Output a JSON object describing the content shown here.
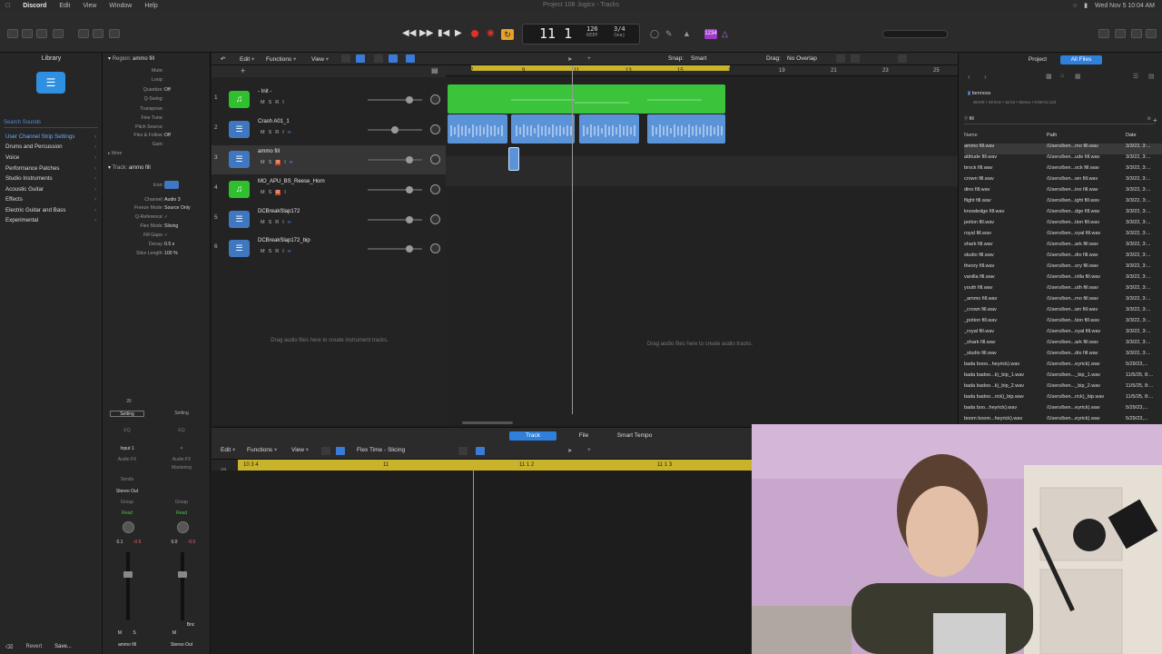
{
  "menubar": {
    "app": "Discord",
    "items": [
      "Edit",
      "View",
      "Window",
      "Help"
    ],
    "window_title": "Project 108 .logicx - Tracks",
    "clock": "Wed Nov 5  10:04 AM"
  },
  "controlbar": {
    "position": "11  1",
    "tempo": "126",
    "tempo_label": "KEEP",
    "signature": "3/4",
    "key": "Cmaj",
    "badge": "1234"
  },
  "library": {
    "title": "Library",
    "search_placeholder": "Search Sounds",
    "items": [
      "User Channel Strip Settings",
      "Drums and Percussion",
      "Voice",
      "Performance Patches",
      "Studio Instruments",
      "Acoustic Guitar",
      "Effects",
      "Electric Guitar and Bass",
      "Experimental"
    ],
    "revert": "Revert",
    "save": "Save..."
  },
  "inspector": {
    "region_label": "Region:",
    "region_name": "ammo fill",
    "rows": [
      {
        "k": "Mute:",
        "v": ""
      },
      {
        "k": "Loop:",
        "v": ""
      },
      {
        "k": "Quantize:",
        "v": "Off"
      },
      {
        "k": "Q-Swing:",
        "v": ""
      },
      {
        "k": "Transpose:",
        "v": ""
      },
      {
        "k": "Fine Tune:",
        "v": ""
      },
      {
        "k": "Pitch Source:",
        "v": ""
      },
      {
        "k": "Flex & Follow:",
        "v": "Off"
      },
      {
        "k": "Gain:",
        "v": ""
      }
    ],
    "more": "More",
    "track_label": "Track:",
    "track_name": "ammo fill",
    "track_rows": [
      {
        "k": "Icon:",
        "v": ""
      },
      {
        "k": "Channel:",
        "v": "Audio 3"
      },
      {
        "k": "Freeze Mode:",
        "v": "Source Only"
      },
      {
        "k": "Q-Reference:",
        "v": ""
      },
      {
        "k": "Flex Mode:",
        "v": "Slicing"
      },
      {
        "k": "Fill Gaps:",
        "v": ""
      },
      {
        "k": "Decay:",
        "v": "0.5 s"
      },
      {
        "k": "Slice Length:",
        "v": "100 %"
      }
    ],
    "strip_left": {
      "setting": "Setting",
      "eq": "EQ",
      "input": "Input 1",
      "fx": "Audio FX",
      "send": "Sends",
      "out": "Stereo Out",
      "group": "Group",
      "read": "Read",
      "val1": "0.1",
      "val2": "-0.9",
      "name": "ammo fill"
    },
    "strip_right": {
      "setting": "Setting",
      "eq": "EQ",
      "fx": "Audio FX",
      "fx2": "Mastering",
      "group": "Group",
      "read": "Read",
      "val1": "0.0",
      "val2": "-0.0",
      "bnc": "Bnc",
      "name": "Stereo Out"
    }
  },
  "tracks_header": {
    "edit": "Edit",
    "functions": "Functions",
    "view": "View",
    "snap_label": "Snap:",
    "snap_value": "Smart",
    "drag_label": "Drag:",
    "drag_value": "No Overlap"
  },
  "ruler": {
    "bars": [
      "7",
      "9",
      "11",
      "13",
      "15",
      "17",
      "19",
      "21",
      "23",
      "25"
    ]
  },
  "tracks": [
    {
      "num": "1",
      "name": "- Init -",
      "type": "midi"
    },
    {
      "num": "2",
      "name": "Crash A01_1",
      "type": "audio"
    },
    {
      "num": "3",
      "name": "ammo fill",
      "type": "audio"
    },
    {
      "num": "4",
      "name": "MO_APU_BS_Reese_Horn",
      "type": "midi"
    },
    {
      "num": "5",
      "name": "DCBreakSlap172",
      "type": "audio"
    },
    {
      "num": "6",
      "name": "DCBreakSlap172_bip",
      "type": "audio"
    }
  ],
  "track_buttons": {
    "m": "M",
    "s": "S",
    "r": "R",
    "i": "I"
  },
  "hints": {
    "instrument": "Drag audio files here to create instrument tracks.",
    "audio": "Drag audio files here to create audio tracks."
  },
  "browser": {
    "tab_project": "Project",
    "tab_all": "All Files",
    "folder": "bennoss",
    "info": "WAVE • 48 kHz • 16 bit • Stereo • 0:00:01:123",
    "search": "fill",
    "col_name": "Name",
    "col_path": "Path",
    "col_date": "Date",
    "files": [
      {
        "n": "ammo fill.wav",
        "p": "/Users/ben...mo fill.wav",
        "d": "3/3/22, 3:..."
      },
      {
        "n": "attitude fill.wav",
        "p": "/Users/ben...ude fill.wav",
        "d": "3/3/22, 3:..."
      },
      {
        "n": "brock fill.wav",
        "p": "/Users/ben...ock fill.wav",
        "d": "3/3/22, 3:..."
      },
      {
        "n": "crown fill.wav",
        "p": "/Users/ben...wn fill.wav",
        "d": "3/3/22, 3:..."
      },
      {
        "n": "dino fill.wav",
        "p": "/Users/ben...ino fill.wav",
        "d": "3/3/22, 3:..."
      },
      {
        "n": "flight fill.wav",
        "p": "/Users/ben...ight fill.wav",
        "d": "3/3/22, 3:..."
      },
      {
        "n": "knowledge fill.wav",
        "p": "/Users/ben...dge fill.wav",
        "d": "3/3/22, 3:..."
      },
      {
        "n": "potion fill.wav",
        "p": "/Users/ben...tion fill.wav",
        "d": "3/3/22, 3:..."
      },
      {
        "n": "royal fill.wav",
        "p": "/Users/ben...oyal fill.wav",
        "d": "3/3/22, 3:..."
      },
      {
        "n": "shark fill.wav",
        "p": "/Users/ben...ark fill.wav",
        "d": "3/3/22, 3:..."
      },
      {
        "n": "studio fill.wav",
        "p": "/Users/ben...dio fill.wav",
        "d": "3/3/22, 3:..."
      },
      {
        "n": "theory fill.wav",
        "p": "/Users/ben...ory fill.wav",
        "d": "3/3/22, 3:..."
      },
      {
        "n": "vanilla fill.wav",
        "p": "/Users/ben...nilla fill.wav",
        "d": "3/3/22, 3:..."
      },
      {
        "n": "youth fill.wav",
        "p": "/Users/ben...uth fill.wav",
        "d": "3/3/22, 3:..."
      },
      {
        "n": "_ammo fill.wav",
        "p": "/Users/ben...mo fill.wav",
        "d": "3/3/22, 3:..."
      },
      {
        "n": "_crown fill.wav",
        "p": "/Users/ben...wn fill.wav",
        "d": "3/3/22, 3:..."
      },
      {
        "n": "_potion fill.wav",
        "p": "/Users/ben...tion fill.wav",
        "d": "3/3/22, 3:..."
      },
      {
        "n": "_royal fill.wav",
        "p": "/Users/ben...oyal fill.wav",
        "d": "3/3/22, 3:..."
      },
      {
        "n": "_shark fill.wav",
        "p": "/Users/ben...ark fill.wav",
        "d": "3/3/22, 3:..."
      },
      {
        "n": "_studio fill.wav",
        "p": "/Users/ben...dio fill.wav",
        "d": "3/3/22, 3:..."
      },
      {
        "n": "bada booo...heyrick).wav",
        "p": "/Users/ben...eyrick).wav",
        "d": "5/29/23,..."
      },
      {
        "n": "bada badoo...k)_bip_1.wav",
        "p": "/Users/ben..._bip_1.wav",
        "d": "11/5/25, 8:..."
      },
      {
        "n": "bada badoo...k)_bip_2.wav",
        "p": "/Users/ben..._bip_2.wav",
        "d": "11/5/25, 8:..."
      },
      {
        "n": "bada badoo...rick)_bip.wav",
        "p": "/Users/ben...rick)_bip.wav",
        "d": "11/5/25, 8:..."
      },
      {
        "n": "bada boo...heyrick).wav",
        "p": "/Users/ben...eyrick).wav",
        "d": "5/29/23,..."
      },
      {
        "n": "boom boom...heyrick).wav",
        "p": "/Users/ben...eyrick).wav",
        "d": "5/29/23,..."
      }
    ]
  },
  "editor": {
    "tab_track": "Track",
    "tab_file": "File",
    "tab_smart": "Smart Tempo",
    "edit": "Edit",
    "functions": "Functions",
    "view": "View",
    "flex": "Flex Time - Slicing",
    "ruler_marks": [
      "10 3 4",
      "11",
      "11 1 2",
      "11 1 3"
    ]
  },
  "colors": {
    "accent_blue": "#2f7fdb",
    "midi_green": "#2fbf2f",
    "audio_blue": "#3f78c0",
    "cycle_yellow": "#c9b32a",
    "record_red": "#e0302a"
  }
}
